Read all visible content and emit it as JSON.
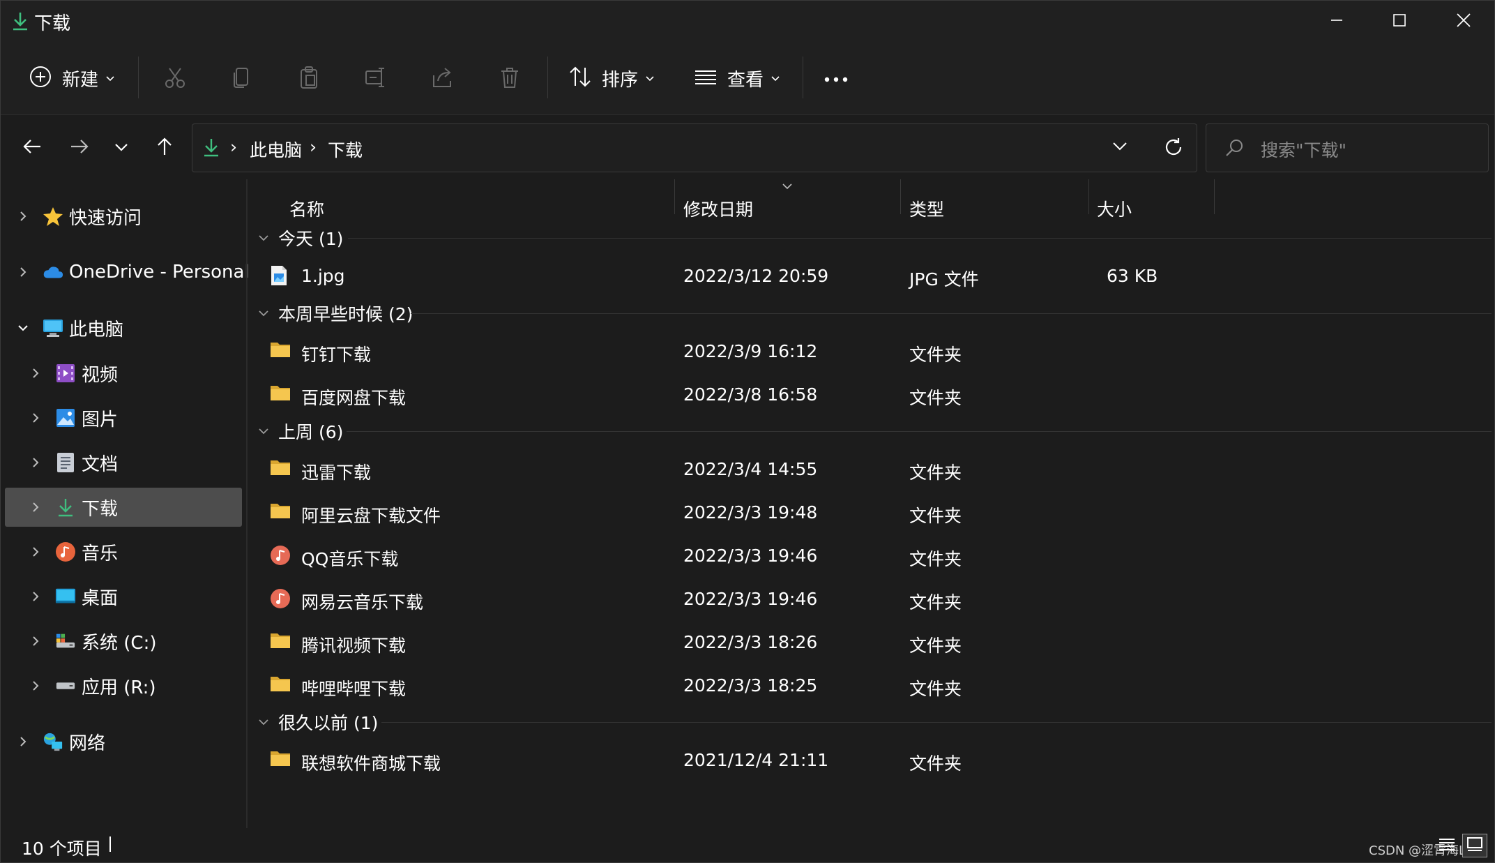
{
  "window": {
    "title": "下载"
  },
  "toolbar": {
    "new_label": "新建",
    "sort_label": "排序",
    "view_label": "查看"
  },
  "address": {
    "crumbs": [
      "此电脑",
      "下载"
    ],
    "search_placeholder": "搜索\"下载\""
  },
  "sidebar": {
    "items": [
      {
        "label": "快速访问",
        "icon": "star-icon"
      },
      {
        "label": "OneDrive - Personal",
        "icon": "cloud-icon"
      },
      {
        "label": "此电脑",
        "icon": "computer-icon"
      },
      {
        "label": "视频",
        "icon": "video-icon"
      },
      {
        "label": "图片",
        "icon": "pictures-icon"
      },
      {
        "label": "文档",
        "icon": "documents-icon"
      },
      {
        "label": "下载",
        "icon": "download-icon"
      },
      {
        "label": "音乐",
        "icon": "music-icon"
      },
      {
        "label": "桌面",
        "icon": "desktop-icon"
      },
      {
        "label": "系统 (C:)",
        "icon": "drive-icon"
      },
      {
        "label": "应用 (R:)",
        "icon": "drive-icon"
      },
      {
        "label": "网络",
        "icon": "network-icon"
      }
    ]
  },
  "columns": {
    "name": "名称",
    "date": "修改日期",
    "type": "类型",
    "size": "大小"
  },
  "groups": [
    {
      "label": "今天 (1)"
    },
    {
      "label": "本周早些时候 (2)"
    },
    {
      "label": "上周 (6)"
    },
    {
      "label": "很久以前 (1)"
    }
  ],
  "files": [
    {
      "name": "1.jpg",
      "date": "2022/3/12 20:59",
      "type": "JPG 文件",
      "size": "63 KB",
      "icon": "image-file-icon"
    },
    {
      "name": "钉钉下载",
      "date": "2022/3/9 16:12",
      "type": "文件夹",
      "size": "",
      "icon": "folder-icon"
    },
    {
      "name": "百度网盘下载",
      "date": "2022/3/8 16:58",
      "type": "文件夹",
      "size": "",
      "icon": "folder-icon"
    },
    {
      "name": "迅雷下载",
      "date": "2022/3/4 14:55",
      "type": "文件夹",
      "size": "",
      "icon": "folder-icon"
    },
    {
      "name": "阿里云盘下载文件",
      "date": "2022/3/3 19:48",
      "type": "文件夹",
      "size": "",
      "icon": "folder-icon"
    },
    {
      "name": "QQ音乐下载",
      "date": "2022/3/3 19:46",
      "type": "文件夹",
      "size": "",
      "icon": "music-folder-icon"
    },
    {
      "name": "网易云音乐下载",
      "date": "2022/3/3 19:46",
      "type": "文件夹",
      "size": "",
      "icon": "music-folder-icon"
    },
    {
      "name": "腾讯视频下载",
      "date": "2022/3/3 18:26",
      "type": "文件夹",
      "size": "",
      "icon": "folder-icon"
    },
    {
      "name": "哔哩哔哩下载",
      "date": "2022/3/3 18:25",
      "type": "文件夹",
      "size": "",
      "icon": "folder-icon"
    },
    {
      "name": "联想软件商城下载",
      "date": "2021/12/4 21:11",
      "type": "文件夹",
      "size": "",
      "icon": "folder-icon"
    }
  ],
  "status": {
    "count": "10 个项目",
    "watermark": "CSDN @涩霄海Lee"
  },
  "colors": {
    "accent": "#4cc2ff",
    "download_green": "#3fbf7f",
    "folder": "#f2c14e",
    "selected_bg": "#4d4d4d"
  }
}
